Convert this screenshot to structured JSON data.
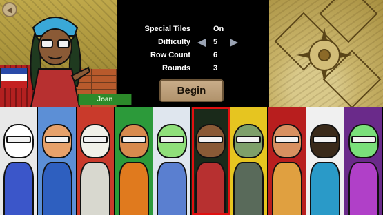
{
  "menu": {
    "rows": [
      {
        "label": "Special Tiles",
        "value": "On"
      },
      {
        "label": "Difficulty",
        "value": "5"
      },
      {
        "label": "Row Count",
        "value": "6"
      },
      {
        "label": "Rounds",
        "value": "3"
      }
    ],
    "begin_label": "Begin"
  },
  "selected_character": {
    "name": "Joan"
  },
  "icons": {
    "back": "back-arrow-icon",
    "decrease": "left-arrow-icon",
    "increase": "right-arrow-icon"
  },
  "colors": {
    "selection_border": "#e01010",
    "name_tag": "#2c8a2a",
    "begin_button": "#b99c74"
  },
  "roster": [
    {
      "id": "ghost",
      "bg": "#e8e8e8",
      "skin": "#ffffff",
      "body": "#3b56c9"
    },
    {
      "id": "brawler",
      "bg": "#5c8fd6",
      "skin": "#e7a16a",
      "body": "#2e5fbf"
    },
    {
      "id": "pirate",
      "bg": "#c93a2b",
      "skin": "#f0f0e8",
      "body": "#d8d8cf"
    },
    {
      "id": "hero",
      "bg": "#2c9a3a",
      "skin": "#d88a4e",
      "body": "#e07a1e"
    },
    {
      "id": "cyborg",
      "bg": "#dfe6ee",
      "skin": "#8fdf7a",
      "body": "#5a7fd0"
    },
    {
      "id": "joan",
      "bg": "#1a2a1a",
      "skin": "#8a5a36",
      "body": "#b73030"
    },
    {
      "id": "robot",
      "bg": "#e6c520",
      "skin": "#7ea06a",
      "body": "#596a5a"
    },
    {
      "id": "scientist",
      "bg": "#b81e1e",
      "skin": "#d89060",
      "body": "#e0a040"
    },
    {
      "id": "ninja",
      "bg": "#f0f0f0",
      "skin": "#3a2a1a",
      "body": "#2a9ac8"
    },
    {
      "id": "alien",
      "bg": "#6a2a8a",
      "skin": "#7adf7a",
      "body": "#b040c8"
    }
  ]
}
